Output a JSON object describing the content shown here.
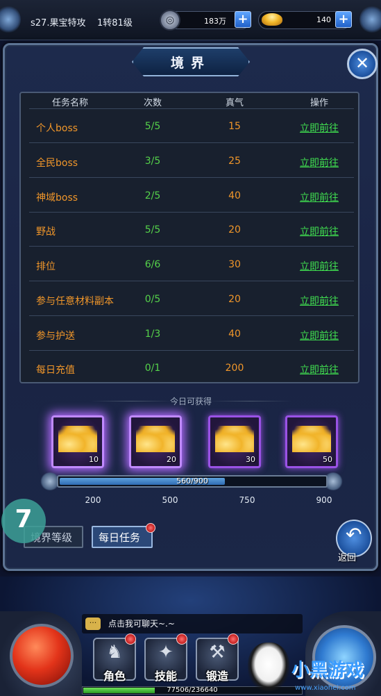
{
  "topbar": {
    "server_name": "s27.果宝特攻",
    "rebirth_level": "1转81级",
    "coins": {
      "value": "183万",
      "icon": "silver-coin-icon"
    },
    "gold": {
      "value": "140",
      "icon": "gold-ingot-icon"
    },
    "plus_symbol": "+"
  },
  "panel": {
    "title": "境界",
    "close_symbol": "✕"
  },
  "task_table": {
    "headers": {
      "name": "任务名称",
      "count": "次数",
      "qi": "真气",
      "action": "操作"
    },
    "rows": [
      {
        "name": "个人boss",
        "count": "5/5",
        "qi": "15",
        "action": "立即前往"
      },
      {
        "name": "全民boss",
        "count": "3/5",
        "qi": "25",
        "action": "立即前往"
      },
      {
        "name": "神域boss",
        "count": "2/5",
        "qi": "40",
        "action": "立即前往"
      },
      {
        "name": "野战",
        "count": "5/5",
        "qi": "20",
        "action": "立即前往"
      },
      {
        "name": "排位",
        "count": "6/6",
        "qi": "30",
        "action": "立即前往"
      },
      {
        "name": "参与任意材料副本",
        "count": "0/5",
        "qi": "20",
        "action": "立即前往"
      },
      {
        "name": "参与护送",
        "count": "1/3",
        "qi": "40",
        "action": "立即前往"
      },
      {
        "name": "每日充值",
        "count": "0/1",
        "qi": "200",
        "action": "立即前往"
      }
    ]
  },
  "rewards": {
    "title": "今日可获得",
    "chests": [
      {
        "count": "10",
        "icon": "gold-ingot-pile-icon",
        "glow": true
      },
      {
        "count": "20",
        "icon": "gold-ingot-pile-icon",
        "glow": true
      },
      {
        "count": "30",
        "icon": "gold-ingot-pile-icon",
        "glow": false
      },
      {
        "count": "50",
        "icon": "gold-ingot-pile-icon",
        "glow": false
      }
    ],
    "progress": {
      "current": 560,
      "max": 900,
      "text": "560/900"
    },
    "milestones": [
      "200",
      "500",
      "750",
      "900"
    ]
  },
  "tabs": {
    "level_badge": "7",
    "realm_level": "境界等级",
    "daily_task": "每日任务"
  },
  "return_button": {
    "label": "返回",
    "icon": "return-arrow-icon",
    "arrow": "↶"
  },
  "hud": {
    "chat_text": "点击我可聊天~.~",
    "chat_icon": "···",
    "menu": [
      {
        "label": "角色",
        "icon": "character-icon",
        "glyph": "♞"
      },
      {
        "label": "技能",
        "icon": "skill-icon",
        "glyph": "✦"
      },
      {
        "label": "锻造",
        "icon": "forge-icon",
        "glyph": "⚒"
      }
    ],
    "exp": {
      "current": 77506,
      "max": 236640,
      "text": "77506/236640"
    }
  },
  "watermark": {
    "text": "小黑游戏",
    "url": "www.xiaohei.com"
  },
  "colors": {
    "accent_orange": "#f0962a",
    "accent_green": "#55d24a",
    "link_green": "#40e050",
    "chest_purple": "#9a52e6"
  }
}
